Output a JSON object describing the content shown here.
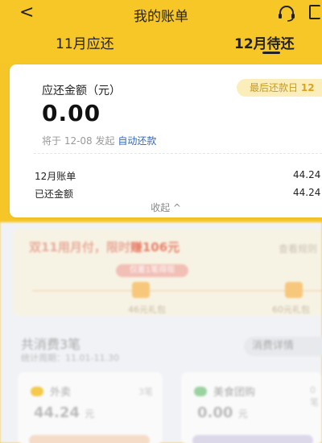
{
  "header": {
    "back_glyph": "<",
    "title": "我的账单",
    "tabs": [
      {
        "label": "11月应还"
      },
      {
        "label": "12月待还"
      }
    ]
  },
  "bill_card": {
    "amount_label": "应还金额（元）",
    "due_prefix": "最后还款日",
    "due_day": "12",
    "amount": "0.00",
    "auto_prefix": "将于 12-08 发起",
    "auto_link": "自动还款",
    "rows": [
      {
        "label": "12月账单",
        "value": "44.24"
      },
      {
        "label": "已还金额",
        "value": "44.24"
      }
    ],
    "collapse_label": "收起 ^"
  },
  "promo": {
    "title_a": "双11用月付，限时",
    "title_b": "赚106元",
    "link": "查看规则",
    "pill": "仅差1笔得现",
    "gift1_label": "46元礼包",
    "gift2_label": "60元礼包"
  },
  "spending": {
    "title": "共消费3笔",
    "period": "统计周期：11.01-11.30",
    "detail_label": "消费详情",
    "categories": [
      {
        "name": "外卖",
        "count": "3笔",
        "amount": "44.24",
        "unit": "元"
      },
      {
        "name": "美食团购",
        "count": "0笔",
        "amount": "0.00",
        "unit": "元"
      }
    ]
  },
  "colors": {
    "brand_yellow": "#f7c627",
    "link_blue": "#2d67c6",
    "due_badge_bg": "#fbeebb"
  },
  "icons": [
    "back-arrow-icon",
    "customer-service-icon",
    "corner-icon",
    "gift-icon",
    "takeout-icon",
    "group-buy-icon"
  ]
}
